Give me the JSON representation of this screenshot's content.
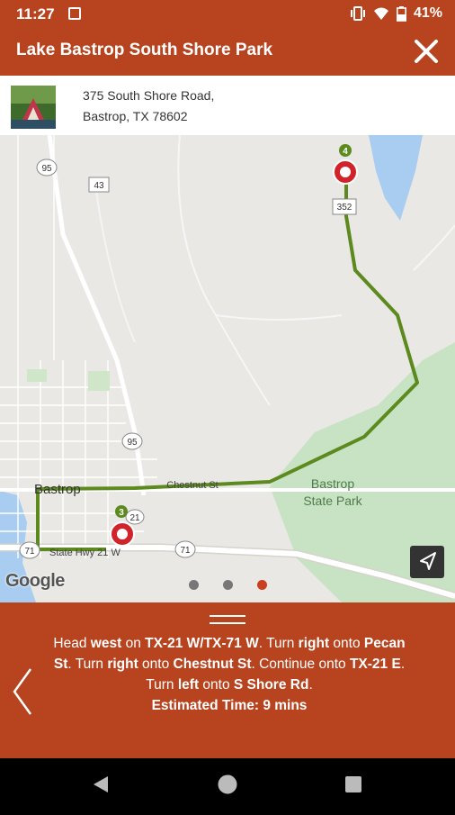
{
  "status": {
    "time": "11:27",
    "battery": "41%"
  },
  "header": {
    "title": "Lake Bastrop South Shore Park"
  },
  "address": {
    "line1": "375 South Shore Road,",
    "line2": "Bastrop, TX 78602"
  },
  "map": {
    "labels": {
      "hwy95_top": "95",
      "hwy43": "43",
      "hwy352": "352",
      "hwy95_mid": "95",
      "hwy21": "21",
      "hwy71_left": "71",
      "hwy71_right": "71",
      "chestnut": "Chestnut St",
      "statehwy": "State Hwy 21 W",
      "bastrop": "Bastrop",
      "park_line1": "Bastrop",
      "park_line2": "State Park",
      "marker_start": "3",
      "marker_end": "4",
      "google": "Google"
    },
    "route_color": "#5c8a1e",
    "page_indicator": {
      "count": 3,
      "active": 3
    }
  },
  "directions": {
    "p1": "Head ",
    "b1": "west",
    "p2": " on ",
    "b2": "TX-21 W/TX-71 W",
    "p3": ". Turn ",
    "b3": "right",
    "p4": " onto ",
    "b4": "Pecan St",
    "p5": ". Turn ",
    "b5": "right",
    "p6": " onto ",
    "b6": "Chestnut St",
    "p7": ". Continue onto ",
    "b7": "TX-21 E",
    "p8": ". Turn ",
    "b8": "left",
    "p9": " onto ",
    "b9": "S Shore Rd",
    "p10": ".",
    "estimated": "Estimated Time: 9 mins"
  },
  "colors": {
    "brand": "#b7441f",
    "park": "#c8e3c4",
    "water": "#a9cdf0"
  }
}
